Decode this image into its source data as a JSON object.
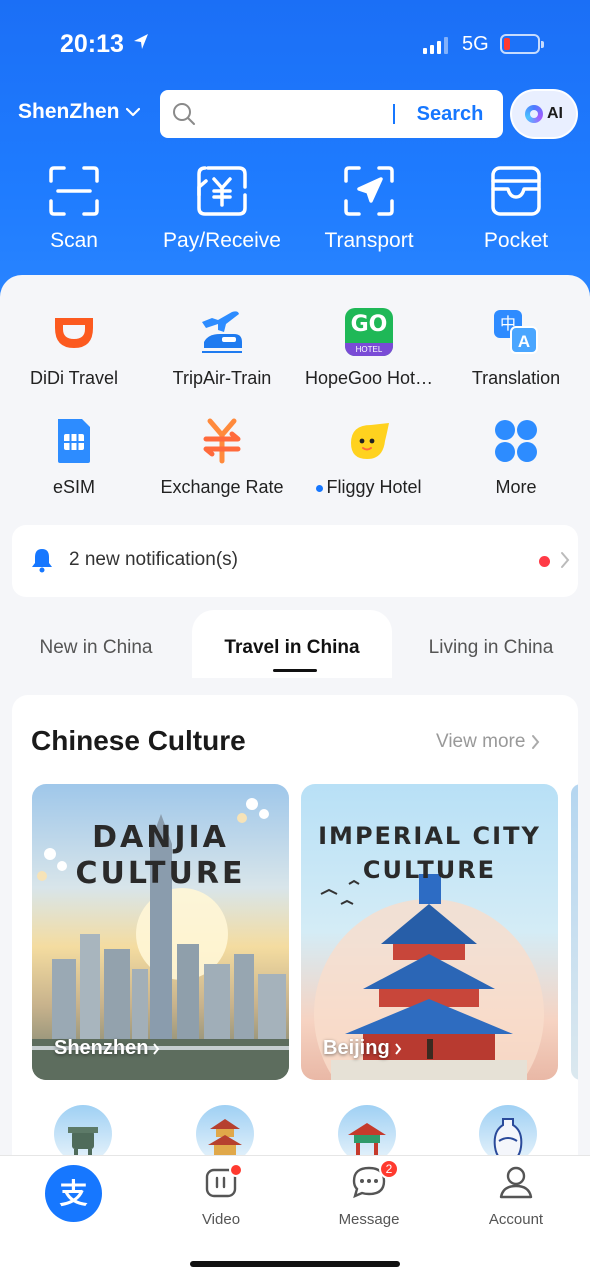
{
  "status_bar": {
    "time": "20:13",
    "network": "5G"
  },
  "header": {
    "city": "ShenZhen",
    "search": {
      "placeholder": "",
      "button": "Search"
    },
    "ai_label": "AI"
  },
  "quick_actions": [
    {
      "label": "Scan",
      "icon": "scan-icon"
    },
    {
      "label": "Pay/Receive",
      "icon": "pay-receive-icon"
    },
    {
      "label": "Transport",
      "icon": "transport-icon"
    },
    {
      "label": "Pocket",
      "icon": "pocket-icon"
    }
  ],
  "apps": [
    {
      "label": "DiDi Travel",
      "icon": "didi-icon"
    },
    {
      "label": "TripAir-Train",
      "icon": "train-icon"
    },
    {
      "label": "HopeGoo Hot…",
      "icon": "hopegoo-icon",
      "icon_text": "GO",
      "icon_sub": "HOTEL"
    },
    {
      "label": "Translation",
      "icon": "translation-icon",
      "icon_text": "中",
      "icon_sub": "A"
    },
    {
      "label": "eSIM",
      "icon": "esim-icon"
    },
    {
      "label": "Exchange Rate",
      "icon": "exchange-rate-icon"
    },
    {
      "label": "Fliggy Hotel",
      "icon": "fliggy-icon"
    },
    {
      "label": "More",
      "icon": "more-icon"
    }
  ],
  "notification": {
    "text": "2 new notification(s)"
  },
  "tabs": [
    {
      "label": "New in China",
      "active": false
    },
    {
      "label": "Travel in China",
      "active": true
    },
    {
      "label": "Living in China",
      "active": false
    }
  ],
  "culture": {
    "title": "Chinese Culture",
    "view_more": "View more",
    "tiles": [
      {
        "title_line1": "DANJIA",
        "title_line2": "CULTURE",
        "caption": "Shenzhen"
      },
      {
        "title_line1": "IMPERIAL CITY",
        "title_line2": "CULTURE",
        "caption": "Beijing"
      }
    ]
  },
  "tabbar": {
    "home_glyph": "支",
    "items": [
      {
        "label": "Video",
        "icon": "video-icon"
      },
      {
        "label": "Message",
        "icon": "message-icon",
        "badge": "2"
      },
      {
        "label": "Account",
        "icon": "account-icon"
      }
    ]
  },
  "colors": {
    "brand_blue": "#1677ff",
    "badge_red": "#ff3a2f"
  }
}
